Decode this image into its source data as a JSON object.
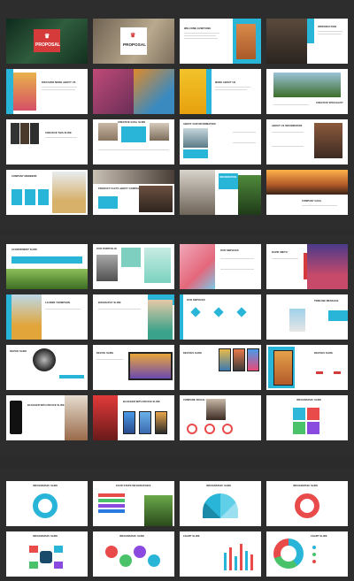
{
  "sections": [
    {
      "name": "section-1",
      "slides": [
        {
          "title": "PROPOSAL",
          "subtitle": "PRESENTATION TEMPLATE"
        },
        {
          "title": "PROPOSAL",
          "subtitle": "PRESENTATION TEMPLATE"
        },
        {
          "title": "WELCOME EVERYONE"
        },
        {
          "title": "INTRODUCTION"
        },
        {
          "title": "DISCOVER MORE ABOUT US"
        },
        {
          "title": ""
        },
        {
          "title": "MORE ABOUT US"
        },
        {
          "title": "CREATIVE SPECIALIST"
        },
        {
          "title": "CREATIVE THIS SLIDE"
        },
        {
          "title": "CREATIVE GOAL SLIDE"
        },
        {
          "title": "ABOUT OUR INFORMATION"
        },
        {
          "title": "ABOUT US INFORMATION"
        },
        {
          "title": "COMPANY MEMBERS"
        },
        {
          "title": "PRODUCT FACTS ABOUT COMPANY"
        },
        {
          "title": "INFORMATION"
        },
        {
          "title": "COMPANY GOAL"
        }
      ]
    },
    {
      "name": "section-2",
      "slides": [
        {
          "title": "ACHIEVEMENT SLIDE"
        },
        {
          "title": "OUR PORTFOLIO"
        },
        {
          "title": "OUR SERVICES"
        },
        {
          "title": "DAVID SMITH"
        },
        {
          "title": "LAUREN THOMPSON"
        },
        {
          "title": "BIOGRAPHY SLIDE"
        },
        {
          "title": "OUR SERVICES"
        },
        {
          "title": "TIMELINE MESSAGE"
        },
        {
          "title": "DEVICE SLIDE"
        },
        {
          "title": "DEVICE SLIDE"
        },
        {
          "title": "DEVICES SLIDE"
        },
        {
          "title": "DEVICES SLIDE"
        },
        {
          "title": "BLOGGER WITH DEVICE SLIDE"
        },
        {
          "title": "BLOGGER WITH DEVICE SLIDE"
        },
        {
          "title": "COMPARE SOCIAL MEDIA"
        },
        {
          "title": "INFOGRAPHIC SLIDE"
        }
      ]
    },
    {
      "name": "section-3",
      "slides": [
        {
          "title": "INFOGRAPHIC SLIDE"
        },
        {
          "title": "FOUR STEPS INFOGRAPHICS"
        },
        {
          "title": "INFOGRAPHIC SLIDE"
        },
        {
          "title": "INFOGRAPHIC SLIDE"
        },
        {
          "title": "INFOGRAPHIC SLIDE"
        },
        {
          "title": "INFOGRAPHIC SLIDE"
        },
        {
          "title": "CHART SLIDE"
        },
        {
          "title": "CHART SLIDE"
        }
      ]
    }
  ],
  "colors": {
    "accent": "#28b5d8",
    "brand_red": "#d63b3b",
    "background": "#2b2b2b"
  }
}
